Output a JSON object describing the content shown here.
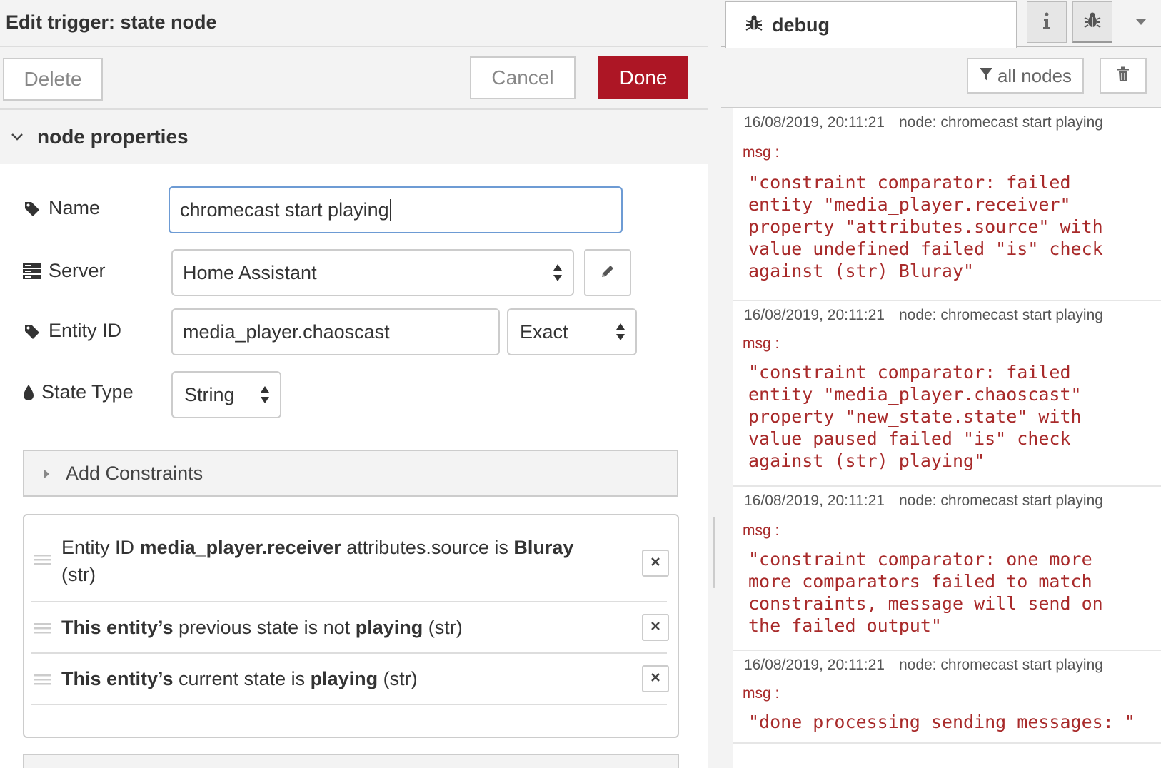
{
  "editor": {
    "title": "Edit trigger: state node",
    "delete_label": "Delete",
    "cancel_label": "Cancel",
    "done_label": "Done",
    "section_label": "node properties",
    "fields": {
      "name_label": "Name",
      "name_value": "chromecast start playing",
      "server_label": "Server",
      "server_value": "Home Assistant",
      "entity_label": "Entity ID",
      "entity_value": "media_player.chaoscast",
      "match_value": "Exact",
      "state_type_label": "State Type",
      "state_type_value": "String"
    },
    "add_constraints_label": "Add Constraints",
    "constraints": [
      {
        "prefix": "Entity ID",
        "entity": "media_player.receiver",
        "middle": "attributes.source is",
        "value": "Bluray",
        "suffix": "(str)"
      },
      {
        "prefix": "This entity’s",
        "middle": "previous state is not",
        "value": "playing",
        "suffix": "(str)"
      },
      {
        "prefix": "This entity’s",
        "middle": "current state is",
        "value": "playing",
        "suffix": "(str)"
      }
    ]
  },
  "debug": {
    "tab_label": "debug",
    "filter_label": "all nodes",
    "messages": [
      {
        "time": "16/08/2019, 20:11:21",
        "node": "node: chromecast start playing",
        "label": "msg :",
        "body": "\"constraint comparator: failed\nentity \"media_player.receiver\"\nproperty \"attributes.source\" with\nvalue undefined failed \"is\" check\nagainst (str) Bluray\""
      },
      {
        "time": "16/08/2019, 20:11:21",
        "node": "node: chromecast start playing",
        "label": "msg :",
        "body": "\"constraint comparator: failed\nentity \"media_player.chaoscast\"\nproperty \"new_state.state\" with\nvalue paused failed \"is\" check\nagainst (str) playing\""
      },
      {
        "time": "16/08/2019, 20:11:21",
        "node": "node: chromecast start playing",
        "label": "msg :",
        "body": "\"constraint comparator: one more\nmore comparators failed to match\nconstraints, message will send on\nthe failed output\""
      },
      {
        "time": "16/08/2019, 20:11:21",
        "node": "node: chromecast start playing",
        "label": "msg :",
        "body": "\"done processing sending messages: \""
      }
    ]
  },
  "icons": {
    "tag": "tag-icon",
    "server": "server-icon",
    "drop": "drop-icon",
    "pencil": "pencil-icon",
    "bug": "bug-icon",
    "info": "info-icon",
    "filter": "filter-icon",
    "trash": "trash-icon",
    "close": "close-icon",
    "handle": "drag-handle-icon"
  },
  "colors": {
    "done": "#ad1625",
    "debug_text": "#a82a2a",
    "focus": "#6d9bd4"
  }
}
